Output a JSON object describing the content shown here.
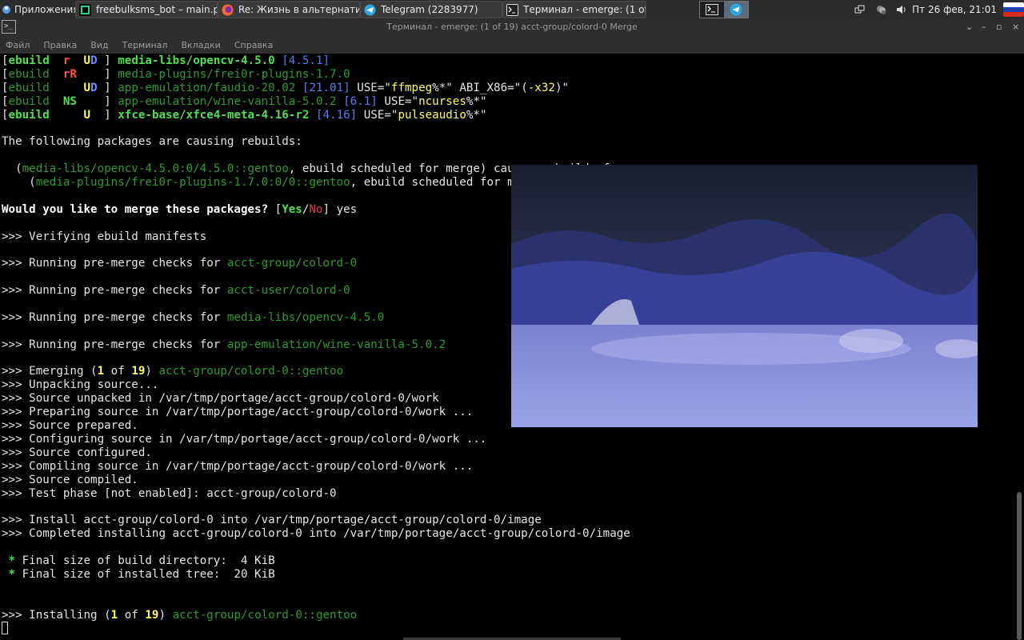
{
  "panel": {
    "apps_label": "Приложения",
    "tasks": [
      {
        "label": "freebulksms_bot – main.py",
        "icon": "pycharm-icon",
        "color": "#21d789"
      },
      {
        "label": "Re: Жизнь в альтернатив...",
        "icon": "firefox-icon",
        "color": "#ff6a2b"
      },
      {
        "label": "Telegram (2283977)",
        "icon": "telegram-icon",
        "color": "#2ea6dd"
      },
      {
        "label": "Терминал - emerge: (1 of ...",
        "icon": "terminal-icon",
        "color": "#dddddd"
      }
    ],
    "clock": "Пт 26 фев, 21:01"
  },
  "window": {
    "title": "Терминал - emerge: (1 of 19) acct-group/colord-0 Merge",
    "controls": [
      "⌄",
      "–",
      "▫",
      "×"
    ]
  },
  "menu": [
    "Файл",
    "Правка",
    "Вид",
    "Терминал",
    "Вкладки",
    "Справка"
  ],
  "terminal": {
    "lines": [
      [
        [
          "[",
          "t"
        ],
        [
          "ebuild",
          "gb"
        ],
        [
          "  ",
          "t"
        ],
        [
          "r",
          "rb"
        ],
        [
          "  ",
          "t"
        ],
        [
          "U",
          "yb"
        ],
        [
          "D",
          "bb"
        ],
        [
          " ] ",
          "t"
        ],
        [
          "media-libs/opencv-4.5.0",
          "gb"
        ],
        [
          " ",
          "t"
        ],
        [
          "[4.5.1]",
          "b"
        ]
      ],
      [
        [
          "[",
          "t"
        ],
        [
          "ebuild",
          "gd"
        ],
        [
          "  ",
          "t"
        ],
        [
          "rR",
          "rb"
        ],
        [
          "    ] ",
          "t"
        ],
        [
          "media-plugins/frei0r-plugins-1.7.0",
          "gd"
        ]
      ],
      [
        [
          "[",
          "t"
        ],
        [
          "ebuild",
          "gd"
        ],
        [
          "     ",
          "t"
        ],
        [
          "U",
          "yb"
        ],
        [
          "D",
          "bb"
        ],
        [
          " ] ",
          "t"
        ],
        [
          "app-emulation/faudio-20.02",
          "gd"
        ],
        [
          " ",
          "t"
        ],
        [
          "[21.01]",
          "b"
        ],
        [
          " USE=\"",
          "t"
        ],
        [
          "ffmpeg",
          "y"
        ],
        [
          "%*\" ABI_X86=\"(",
          "t"
        ],
        [
          "-x32",
          "y"
        ],
        [
          ")\"",
          "t"
        ]
      ],
      [
        [
          "[",
          "t"
        ],
        [
          "ebuild",
          "gd"
        ],
        [
          "  ",
          "t"
        ],
        [
          "NS",
          "gb"
        ],
        [
          "    ] ",
          "t"
        ],
        [
          "app-emulation/wine-vanilla-5.0.2",
          "gd"
        ],
        [
          " ",
          "t"
        ],
        [
          "[6.1]",
          "b"
        ],
        [
          " USE=\"",
          "t"
        ],
        [
          "ncurses",
          "y"
        ],
        [
          "%*\"",
          "t"
        ]
      ],
      [
        [
          "[",
          "t"
        ],
        [
          "ebuild",
          "gb"
        ],
        [
          "     ",
          "t"
        ],
        [
          "U",
          "yb"
        ],
        [
          "  ] ",
          "t"
        ],
        [
          "xfce-base/xfce4-meta-4.16-r2",
          "gb"
        ],
        [
          " ",
          "t"
        ],
        [
          "[4.16]",
          "b"
        ],
        [
          " USE=\"",
          "t"
        ],
        [
          "pulseaudio",
          "y"
        ],
        [
          "%*\"",
          "t"
        ]
      ],
      [],
      [
        [
          "The following packages are causing rebuilds:",
          "t"
        ]
      ],
      [],
      [
        [
          "  (",
          "t"
        ],
        [
          "media-libs/opencv-4.5.0:0/4.5.0::gentoo",
          "gd"
        ],
        [
          ", ebuild scheduled for merge) causes rebuilds for:",
          "t"
        ]
      ],
      [
        [
          "    (",
          "t"
        ],
        [
          "media-plugins/frei0r-plugins-1.7.0:0/0::gentoo",
          "gd"
        ],
        [
          ", ebuild scheduled for merge)",
          "t"
        ]
      ],
      [],
      [
        [
          "Would you like to merge these packages?",
          "w"
        ],
        [
          " [",
          "t"
        ],
        [
          "Yes",
          "gb"
        ],
        [
          "/",
          "t"
        ],
        [
          "No",
          "r"
        ],
        [
          "] yes",
          "t"
        ]
      ],
      [],
      [
        [
          ">>> Verifying ebuild manifests",
          "t"
        ]
      ],
      [],
      [
        [
          ">>> Running pre-merge checks for ",
          "t"
        ],
        [
          "acct-group/colord-0",
          "gd"
        ]
      ],
      [],
      [
        [
          ">>> Running pre-merge checks for ",
          "t"
        ],
        [
          "acct-user/colord-0",
          "gd"
        ]
      ],
      [],
      [
        [
          ">>> Running pre-merge checks for ",
          "t"
        ],
        [
          "media-libs/opencv-4.5.0",
          "gd"
        ]
      ],
      [],
      [
        [
          ">>> Running pre-merge checks for ",
          "t"
        ],
        [
          "app-emulation/wine-vanilla-5.0.2",
          "gd"
        ]
      ],
      [],
      [
        [
          ">>> Emerging (",
          "t"
        ],
        [
          "1",
          "yb"
        ],
        [
          " of ",
          "t"
        ],
        [
          "19",
          "yb"
        ],
        [
          ") ",
          "t"
        ],
        [
          "acct-group/colord-0::gentoo",
          "gd"
        ]
      ],
      [
        [
          ">>> Unpacking source...",
          "t"
        ]
      ],
      [
        [
          ">>> Source unpacked in /var/tmp/portage/acct-group/colord-0/work",
          "t"
        ]
      ],
      [
        [
          ">>> Preparing source in /var/tmp/portage/acct-group/colord-0/work ...",
          "t"
        ]
      ],
      [
        [
          ">>> Source prepared.",
          "t"
        ]
      ],
      [
        [
          ">>> Configuring source in /var/tmp/portage/acct-group/colord-0/work ...",
          "t"
        ]
      ],
      [
        [
          ">>> Source configured.",
          "t"
        ]
      ],
      [
        [
          ">>> Compiling source in /var/tmp/portage/acct-group/colord-0/work ...",
          "t"
        ]
      ],
      [
        [
          ">>> Source compiled.",
          "t"
        ]
      ],
      [
        [
          ">>> Test phase [not enabled]: acct-group/colord-0",
          "t"
        ]
      ],
      [],
      [
        [
          ">>> Install acct-group/colord-0 into /var/tmp/portage/acct-group/colord-0/image",
          "t"
        ]
      ],
      [
        [
          ">>> Completed installing acct-group/colord-0 into /var/tmp/portage/acct-group/colord-0/image",
          "t"
        ]
      ],
      [],
      [
        [
          " ",
          "t"
        ],
        [
          "*",
          "gb"
        ],
        [
          " Final size of build directory:  4 KiB",
          "t"
        ]
      ],
      [
        [
          " ",
          "t"
        ],
        [
          "*",
          "gb"
        ],
        [
          " Final size of installed tree:  20 KiB",
          "t"
        ]
      ],
      [],
      [],
      [
        [
          ">>> Installing (",
          "t"
        ],
        [
          "1",
          "yb"
        ],
        [
          " of ",
          "t"
        ],
        [
          "19",
          "yb"
        ],
        [
          ") ",
          "t"
        ],
        [
          "acct-group/colord-0::gentoo",
          "gd"
        ]
      ]
    ]
  }
}
